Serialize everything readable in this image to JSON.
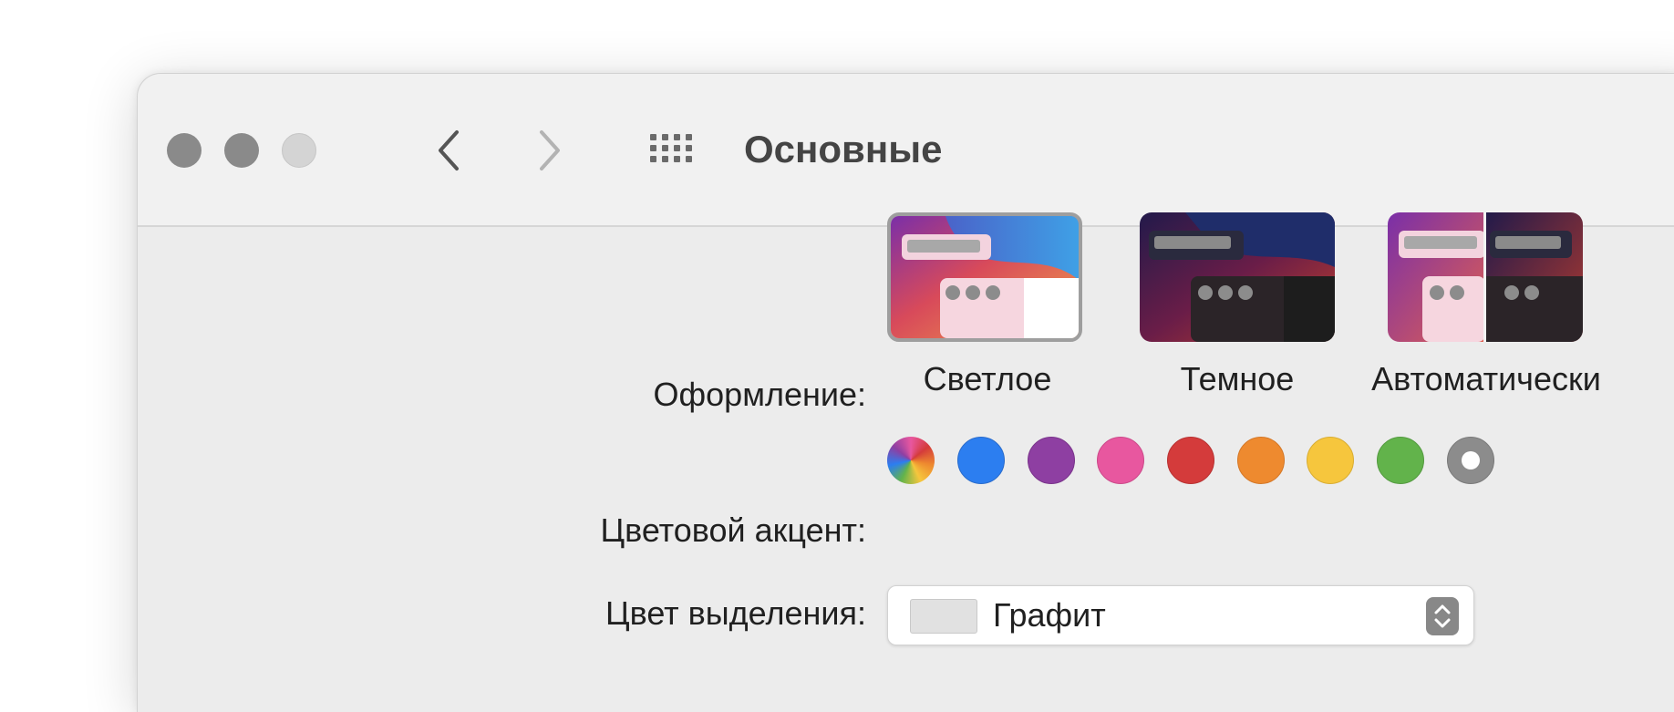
{
  "window": {
    "title": "Основные",
    "traffic_lights": [
      {
        "name": "close",
        "color": "#8a8a8a"
      },
      {
        "name": "minimize",
        "color": "#8a8a8a"
      },
      {
        "name": "zoom",
        "color": "#d4d4d4"
      }
    ],
    "toolbar_icons": [
      "back-chevron-icon",
      "forward-chevron-icon",
      "grid-icon"
    ]
  },
  "appearance": {
    "label": "Оформление:",
    "options": [
      {
        "label": "Светлое",
        "selected": true
      },
      {
        "label": "Темное",
        "selected": false
      },
      {
        "label": "Автоматически",
        "selected": false
      }
    ]
  },
  "accent": {
    "label": "Цветовой акцент:",
    "colors": [
      {
        "name": "multicolor",
        "value": "multicolor"
      },
      {
        "name": "blue",
        "value": "#2c7ef0"
      },
      {
        "name": "purple",
        "value": "#8e3fa2"
      },
      {
        "name": "pink",
        "value": "#e8579f"
      },
      {
        "name": "red",
        "value": "#d43b3b"
      },
      {
        "name": "orange",
        "value": "#ee8a2f"
      },
      {
        "name": "yellow",
        "value": "#f6c63d"
      },
      {
        "name": "green",
        "value": "#62b34b"
      },
      {
        "name": "graphite",
        "value": "#8c8c8c",
        "selected": true
      }
    ]
  },
  "highlight": {
    "label": "Цвет выделения:",
    "value": "Графит",
    "swatch_color": "#e1e1e1"
  }
}
